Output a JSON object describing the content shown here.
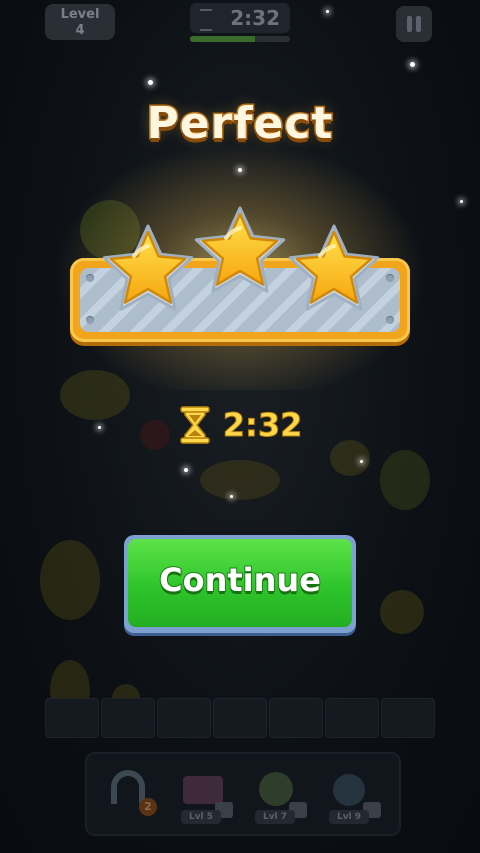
{
  "hud": {
    "level_label": "Level",
    "level_number": "4",
    "timer": "2:32",
    "timer_progress": 0.65
  },
  "result": {
    "title": "Perfect",
    "stars_earned": 3,
    "stars_total": 3,
    "time": "2:32",
    "continue_label": "Continue"
  },
  "boosters": [
    {
      "icon": "magnet-icon",
      "badge": "2"
    },
    {
      "icon": "books-icon",
      "label": "Lvl 5"
    },
    {
      "icon": "fan-icon",
      "label": "Lvl 7"
    },
    {
      "icon": "bomb-icon",
      "label": "Lvl 9"
    }
  ],
  "colors": {
    "title_fill": "#fff6e0",
    "title_stroke": "#b46a12",
    "star_gold": "#ffc21a",
    "continue_green": "#2ec42b",
    "time_yellow": "#ffd84a"
  }
}
